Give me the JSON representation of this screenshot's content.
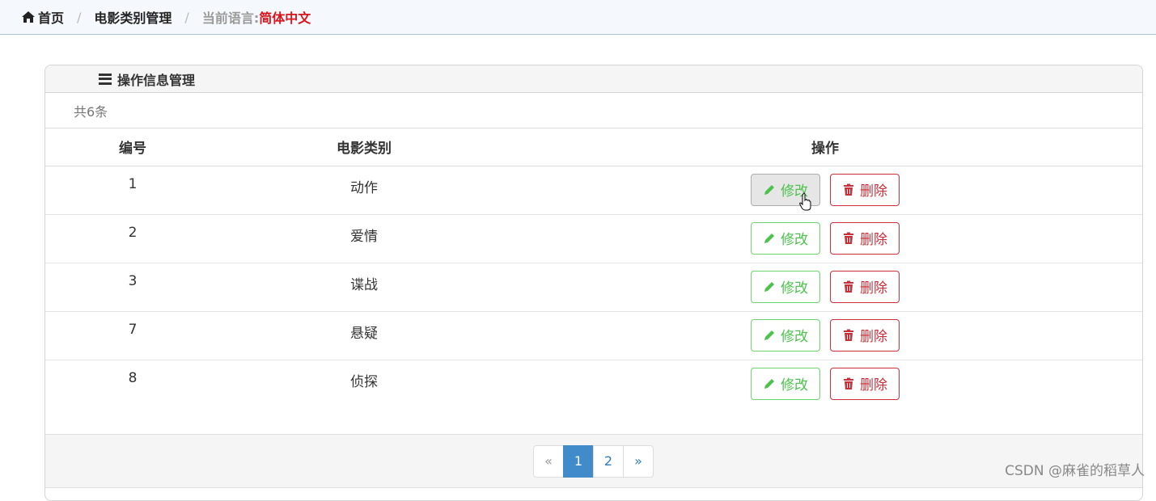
{
  "breadcrumb": {
    "home": "首页",
    "section": "电影类别管理",
    "lang_label": "当前语言:",
    "lang_value": "简体中文"
  },
  "panel": {
    "title": "操作信息管理",
    "count": "共6条"
  },
  "table": {
    "headers": [
      "编号",
      "电影类别",
      "操作"
    ],
    "rows": [
      {
        "id": "1",
        "category": "动作"
      },
      {
        "id": "2",
        "category": "爱情"
      },
      {
        "id": "3",
        "category": "谍战"
      },
      {
        "id": "7",
        "category": "悬疑"
      },
      {
        "id": "8",
        "category": "侦探"
      }
    ],
    "edit_label": "修改",
    "delete_label": "删除"
  },
  "pagination": {
    "prev": "«",
    "pages": [
      "1",
      "2"
    ],
    "current": "1",
    "next": "»"
  },
  "watermark": "CSDN @麻雀的稻草人",
  "colors": {
    "edit": "#4cc24c",
    "delete": "#c9303a",
    "lang_value": "#d9141c",
    "active_page": "#428bca"
  },
  "icons": [
    "home-icon",
    "list-icon",
    "pencil-icon",
    "trash-icon"
  ]
}
